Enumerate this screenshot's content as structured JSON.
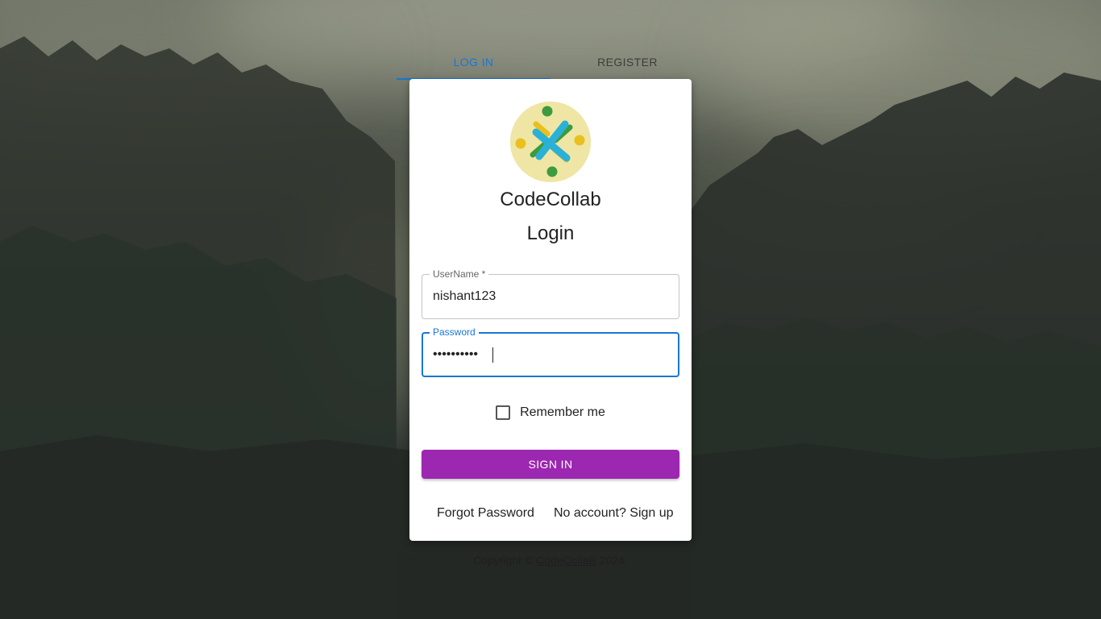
{
  "tabs": [
    {
      "label": "LOG IN",
      "active": true
    },
    {
      "label": "REGISTER",
      "active": false
    }
  ],
  "card": {
    "logo_icon": "codecollab-logo",
    "brand": "CodeCollab",
    "heading": "Login",
    "username": {
      "label": "UserName *",
      "value": "nishant123"
    },
    "password": {
      "label": "Password",
      "value": "••••••••••"
    },
    "remember_label": "Remember me",
    "remember_checked": false,
    "signin_label": "SIGN IN",
    "forgot_label": "Forgot Password",
    "signup_label": "No account? Sign up"
  },
  "footer": {
    "prefix": "Copyright © ",
    "brand": "CodeCollaB",
    "suffix": " 2024."
  },
  "colors": {
    "primary": "#1976d2",
    "signin_button": "#9c27b0",
    "logo_background": "#efe6a5"
  }
}
